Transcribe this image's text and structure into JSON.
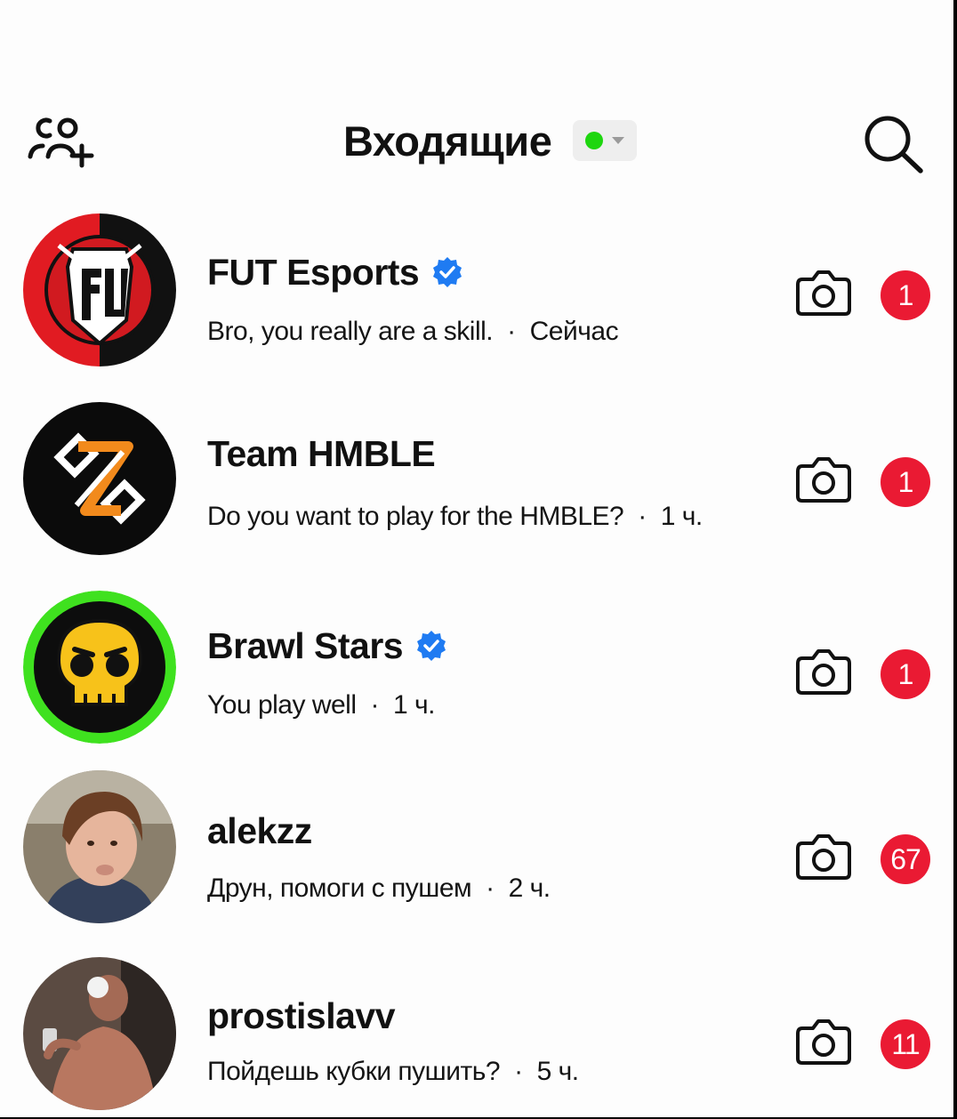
{
  "header": {
    "title": "Входящие",
    "status_color": "#1ed60f"
  },
  "badge_color": "#ea1a33",
  "verified_color": "#1f7bf2",
  "threads": [
    {
      "name": "FUT Esports",
      "verified": true,
      "message": "Bro, you really are a skill.",
      "time": "Сейчас",
      "unread": "1"
    },
    {
      "name": "Team HMBLE",
      "verified": false,
      "message": "Do you want to play for the HMBLE?",
      "time": "1 ч.",
      "unread": "1"
    },
    {
      "name": "Brawl Stars",
      "verified": true,
      "message": "You play well",
      "time": "1 ч.",
      "unread": "1"
    },
    {
      "name": "alekzz",
      "verified": false,
      "message": "Друн, помоги с пушем",
      "time": "2 ч.",
      "unread": "67"
    },
    {
      "name": "prostislavv",
      "verified": false,
      "message": "Пойдешь кубки пушить?",
      "time": "5 ч.",
      "unread": "11"
    }
  ]
}
